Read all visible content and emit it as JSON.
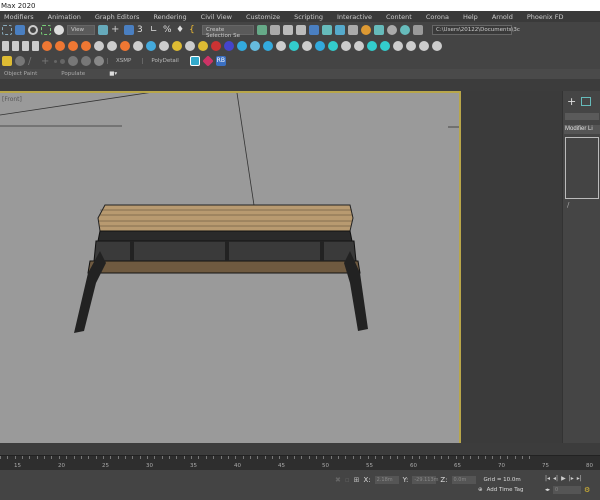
{
  "title": "Max 2020",
  "menu": [
    "Modifiers",
    "Animation",
    "Graph Editors",
    "Rendering",
    "Civil View",
    "Customize",
    "Scripting",
    "Interactive",
    "Content",
    "Corona",
    "Help",
    "Arnold",
    "Phoenix FD"
  ],
  "toolbar": {
    "view_select": "View",
    "selection_set": "Create Selection Se",
    "path": "C:\\Users\\20122\\Documents\\3c"
  },
  "toolbar3": {
    "xsmp": "XSMP",
    "polydetail": "PolyDetail",
    "rb": "RB"
  },
  "ribbon": {
    "object_paint": "Object Paint",
    "populate": "Populate"
  },
  "viewport": {
    "label": "[Front]"
  },
  "command_panel": {
    "modifier_list": "Modifier Li"
  },
  "timeline": {
    "labels": [
      "15",
      "20",
      "25",
      "30",
      "35",
      "40",
      "45",
      "50",
      "55",
      "60",
      "65",
      "70",
      "75",
      "80"
    ]
  },
  "status": {
    "x_label": "X:",
    "x": "2.18m",
    "y_label": "Y:",
    "y": "-29.113m",
    "z_label": "Z:",
    "z": "0.0m",
    "grid": "Grid = 10.0m",
    "add_time_tag": "Add Time Tag",
    "frame": "0"
  },
  "colors": {
    "viewport_border": "#b8a64a",
    "viewport_bg": "#9a9a9a",
    "accent": "#4a7fc1"
  }
}
